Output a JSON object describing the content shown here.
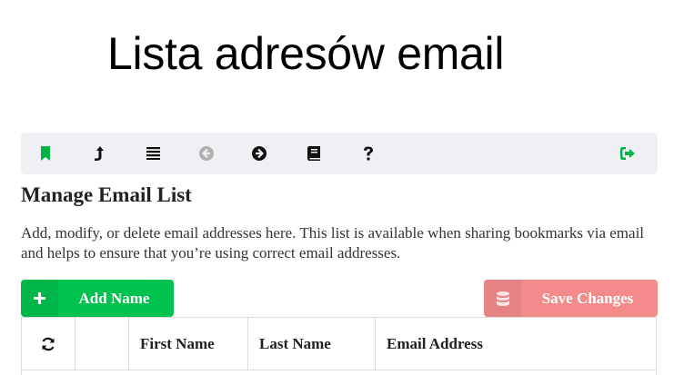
{
  "page": {
    "title": "Lista adresów email"
  },
  "toolbar": {
    "icons": [
      {
        "name": "bookmark-icon",
        "color": "#00b347"
      },
      {
        "name": "share-icon",
        "color": "#111111"
      },
      {
        "name": "list-icon",
        "color": "#111111"
      },
      {
        "name": "back-icon",
        "color": "#b0b0b0"
      },
      {
        "name": "forward-icon",
        "color": "#111111"
      },
      {
        "name": "book-icon",
        "color": "#111111"
      },
      {
        "name": "help-icon",
        "color": "#111111"
      },
      {
        "name": "signout-icon",
        "color": "#00b347"
      }
    ]
  },
  "section": {
    "title": "Manage Email List",
    "description": "Add, modify, or delete email addresses here. This list is available when sharing bookmarks via email and helps to ensure that you’re using correct email addresses."
  },
  "buttons": {
    "add_label": "Add Name",
    "add_icon": "plus-icon",
    "add_color": "#00c24e",
    "save_label": "Save Changes",
    "save_icon": "database-icon",
    "save_color": "#f48b8b"
  },
  "table": {
    "refresh_icon": "refresh-icon",
    "columns": [
      "First Name",
      "Last Name",
      "Email Address"
    ]
  }
}
